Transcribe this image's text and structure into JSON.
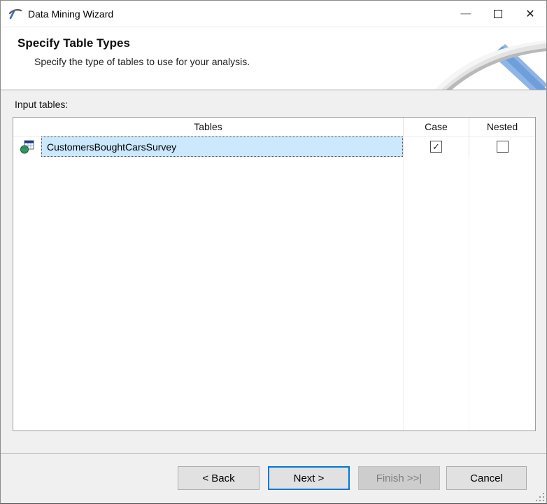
{
  "window": {
    "title": "Data Mining Wizard",
    "controls": {
      "minimize_glyph": "—",
      "close_glyph": "✕"
    }
  },
  "header": {
    "title": "Specify Table Types",
    "subtitle": "Specify the type of tables to use for your analysis."
  },
  "content": {
    "input_tables_label": "Input tables:",
    "table": {
      "columns": [
        "Tables",
        "Case",
        "Nested"
      ],
      "check_glyph": "✓",
      "rows": [
        {
          "name": "CustomersBoughtCarsSurvey",
          "icon": "table-icon",
          "case_checked": true,
          "nested_checked": false,
          "selected": true
        }
      ]
    }
  },
  "footer": {
    "back_label": "< Back",
    "next_label": "Next >",
    "finish_label": "Finish >>|",
    "cancel_label": "Cancel"
  },
  "colors": {
    "selection_fill": "#cbe8fc",
    "focus_border": "#0078d7",
    "button_face": "#e1e1e1",
    "disabled_face": "#cdcdcd",
    "content_bg": "#f0f0f0",
    "banner_bg": "#ffffff"
  }
}
